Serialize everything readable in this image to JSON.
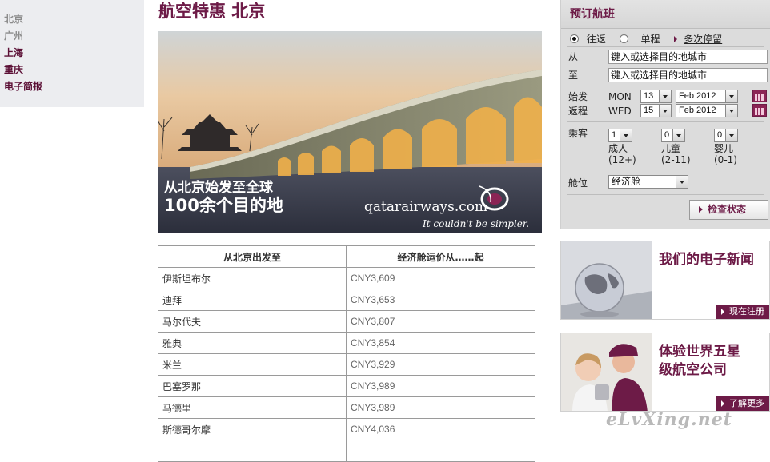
{
  "sidebar": {
    "items": [
      {
        "label": "北京"
      },
      {
        "label": "广州"
      },
      {
        "label": "上海"
      },
      {
        "label": "重庆"
      },
      {
        "label": "电子简报"
      }
    ]
  },
  "page": {
    "title": "航空特惠 北京"
  },
  "banner": {
    "slogan_line1": "从北京始发至全球",
    "slogan_line2": "100余个目的地",
    "brand": "qatarairways.com",
    "tagline": "It couldn't be simpler."
  },
  "fares": {
    "col_destination": "从北京出发至",
    "col_price": "经济舱运价从……起",
    "rows": [
      {
        "dest": "伊斯坦布尔",
        "price": "CNY3,609"
      },
      {
        "dest": "迪拜",
        "price": "CNY3,653"
      },
      {
        "dest": "马尔代夫",
        "price": "CNY3,807"
      },
      {
        "dest": "雅典",
        "price": "CNY3,854"
      },
      {
        "dest": "米兰",
        "price": "CNY3,929"
      },
      {
        "dest": "巴塞罗那",
        "price": "CNY3,989"
      },
      {
        "dest": "马德里",
        "price": "CNY3,989"
      },
      {
        "dest": "斯德哥尔摩",
        "price": "CNY4,036"
      }
    ]
  },
  "booking": {
    "title": "预订航班",
    "trip_roundtrip": "往返",
    "trip_oneway": "单程",
    "trip_multi": "多次停留",
    "from_label": "从",
    "from_placeholder": "键入或选择目的地城市",
    "to_label": "至",
    "to_placeholder": "键入或选择目的地城市",
    "depart_label": "始发",
    "depart_weekday": "MON",
    "depart_day": "13",
    "depart_month": "Feb 2012",
    "return_label": "返程",
    "return_weekday": "WED",
    "return_day": "15",
    "return_month": "Feb 2012",
    "passengers_label": "乘客",
    "adults_value": "1",
    "adults_label": "成人",
    "adults_age": "(12+)",
    "children_value": "0",
    "children_label": "儿童",
    "children_age": "(2-11)",
    "infants_value": "0",
    "infants_label": "婴儿",
    "infants_age": "(0-1)",
    "cabin_label": "舱位",
    "cabin_value": "经济舱",
    "check_button": "检查状态"
  },
  "promos": {
    "newsletter_text": "我们的电子新闻",
    "newsletter_button": "现在注册",
    "service_text_line1": "体验世界五星",
    "service_text_line2": "级航空公司",
    "service_button": "了解更多"
  },
  "watermark": "eLvXing.net",
  "colors": {
    "brand": "#6d1b47",
    "panel": "#dcdcdc"
  }
}
